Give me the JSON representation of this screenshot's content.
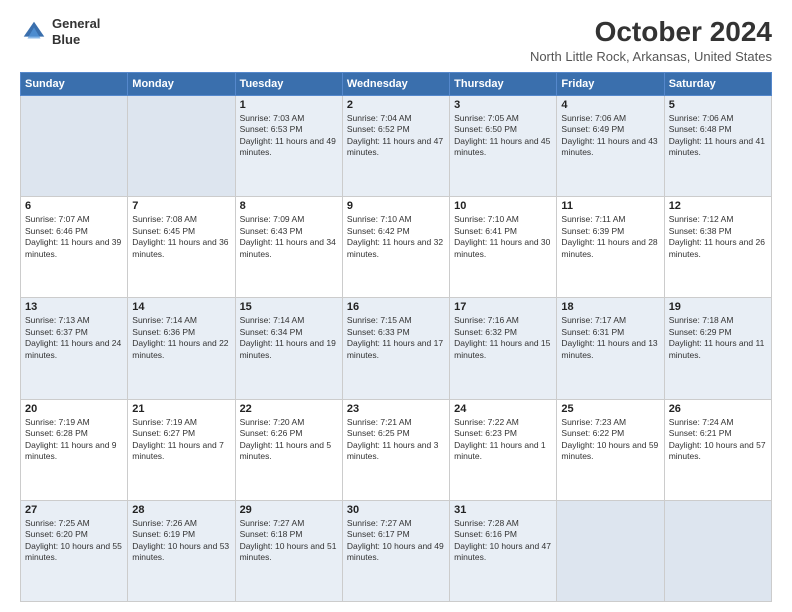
{
  "header": {
    "logo_line1": "General",
    "logo_line2": "Blue",
    "month": "October 2024",
    "location": "North Little Rock, Arkansas, United States"
  },
  "days_of_week": [
    "Sunday",
    "Monday",
    "Tuesday",
    "Wednesday",
    "Thursday",
    "Friday",
    "Saturday"
  ],
  "weeks": [
    [
      {
        "day": "",
        "empty": true
      },
      {
        "day": "",
        "empty": true
      },
      {
        "day": "1",
        "sunrise": "Sunrise: 7:03 AM",
        "sunset": "Sunset: 6:53 PM",
        "daylight": "Daylight: 11 hours and 49 minutes."
      },
      {
        "day": "2",
        "sunrise": "Sunrise: 7:04 AM",
        "sunset": "Sunset: 6:52 PM",
        "daylight": "Daylight: 11 hours and 47 minutes."
      },
      {
        "day": "3",
        "sunrise": "Sunrise: 7:05 AM",
        "sunset": "Sunset: 6:50 PM",
        "daylight": "Daylight: 11 hours and 45 minutes."
      },
      {
        "day": "4",
        "sunrise": "Sunrise: 7:06 AM",
        "sunset": "Sunset: 6:49 PM",
        "daylight": "Daylight: 11 hours and 43 minutes."
      },
      {
        "day": "5",
        "sunrise": "Sunrise: 7:06 AM",
        "sunset": "Sunset: 6:48 PM",
        "daylight": "Daylight: 11 hours and 41 minutes."
      }
    ],
    [
      {
        "day": "6",
        "sunrise": "Sunrise: 7:07 AM",
        "sunset": "Sunset: 6:46 PM",
        "daylight": "Daylight: 11 hours and 39 minutes."
      },
      {
        "day": "7",
        "sunrise": "Sunrise: 7:08 AM",
        "sunset": "Sunset: 6:45 PM",
        "daylight": "Daylight: 11 hours and 36 minutes."
      },
      {
        "day": "8",
        "sunrise": "Sunrise: 7:09 AM",
        "sunset": "Sunset: 6:43 PM",
        "daylight": "Daylight: 11 hours and 34 minutes."
      },
      {
        "day": "9",
        "sunrise": "Sunrise: 7:10 AM",
        "sunset": "Sunset: 6:42 PM",
        "daylight": "Daylight: 11 hours and 32 minutes."
      },
      {
        "day": "10",
        "sunrise": "Sunrise: 7:10 AM",
        "sunset": "Sunset: 6:41 PM",
        "daylight": "Daylight: 11 hours and 30 minutes."
      },
      {
        "day": "11",
        "sunrise": "Sunrise: 7:11 AM",
        "sunset": "Sunset: 6:39 PM",
        "daylight": "Daylight: 11 hours and 28 minutes."
      },
      {
        "day": "12",
        "sunrise": "Sunrise: 7:12 AM",
        "sunset": "Sunset: 6:38 PM",
        "daylight": "Daylight: 11 hours and 26 minutes."
      }
    ],
    [
      {
        "day": "13",
        "sunrise": "Sunrise: 7:13 AM",
        "sunset": "Sunset: 6:37 PM",
        "daylight": "Daylight: 11 hours and 24 minutes."
      },
      {
        "day": "14",
        "sunrise": "Sunrise: 7:14 AM",
        "sunset": "Sunset: 6:36 PM",
        "daylight": "Daylight: 11 hours and 22 minutes."
      },
      {
        "day": "15",
        "sunrise": "Sunrise: 7:14 AM",
        "sunset": "Sunset: 6:34 PM",
        "daylight": "Daylight: 11 hours and 19 minutes."
      },
      {
        "day": "16",
        "sunrise": "Sunrise: 7:15 AM",
        "sunset": "Sunset: 6:33 PM",
        "daylight": "Daylight: 11 hours and 17 minutes."
      },
      {
        "day": "17",
        "sunrise": "Sunrise: 7:16 AM",
        "sunset": "Sunset: 6:32 PM",
        "daylight": "Daylight: 11 hours and 15 minutes."
      },
      {
        "day": "18",
        "sunrise": "Sunrise: 7:17 AM",
        "sunset": "Sunset: 6:31 PM",
        "daylight": "Daylight: 11 hours and 13 minutes."
      },
      {
        "day": "19",
        "sunrise": "Sunrise: 7:18 AM",
        "sunset": "Sunset: 6:29 PM",
        "daylight": "Daylight: 11 hours and 11 minutes."
      }
    ],
    [
      {
        "day": "20",
        "sunrise": "Sunrise: 7:19 AM",
        "sunset": "Sunset: 6:28 PM",
        "daylight": "Daylight: 11 hours and 9 minutes."
      },
      {
        "day": "21",
        "sunrise": "Sunrise: 7:19 AM",
        "sunset": "Sunset: 6:27 PM",
        "daylight": "Daylight: 11 hours and 7 minutes."
      },
      {
        "day": "22",
        "sunrise": "Sunrise: 7:20 AM",
        "sunset": "Sunset: 6:26 PM",
        "daylight": "Daylight: 11 hours and 5 minutes."
      },
      {
        "day": "23",
        "sunrise": "Sunrise: 7:21 AM",
        "sunset": "Sunset: 6:25 PM",
        "daylight": "Daylight: 11 hours and 3 minutes."
      },
      {
        "day": "24",
        "sunrise": "Sunrise: 7:22 AM",
        "sunset": "Sunset: 6:23 PM",
        "daylight": "Daylight: 11 hours and 1 minute."
      },
      {
        "day": "25",
        "sunrise": "Sunrise: 7:23 AM",
        "sunset": "Sunset: 6:22 PM",
        "daylight": "Daylight: 10 hours and 59 minutes."
      },
      {
        "day": "26",
        "sunrise": "Sunrise: 7:24 AM",
        "sunset": "Sunset: 6:21 PM",
        "daylight": "Daylight: 10 hours and 57 minutes."
      }
    ],
    [
      {
        "day": "27",
        "sunrise": "Sunrise: 7:25 AM",
        "sunset": "Sunset: 6:20 PM",
        "daylight": "Daylight: 10 hours and 55 minutes."
      },
      {
        "day": "28",
        "sunrise": "Sunrise: 7:26 AM",
        "sunset": "Sunset: 6:19 PM",
        "daylight": "Daylight: 10 hours and 53 minutes."
      },
      {
        "day": "29",
        "sunrise": "Sunrise: 7:27 AM",
        "sunset": "Sunset: 6:18 PM",
        "daylight": "Daylight: 10 hours and 51 minutes."
      },
      {
        "day": "30",
        "sunrise": "Sunrise: 7:27 AM",
        "sunset": "Sunset: 6:17 PM",
        "daylight": "Daylight: 10 hours and 49 minutes."
      },
      {
        "day": "31",
        "sunrise": "Sunrise: 7:28 AM",
        "sunset": "Sunset: 6:16 PM",
        "daylight": "Daylight: 10 hours and 47 minutes."
      },
      {
        "day": "",
        "empty": true
      },
      {
        "day": "",
        "empty": true
      }
    ]
  ]
}
